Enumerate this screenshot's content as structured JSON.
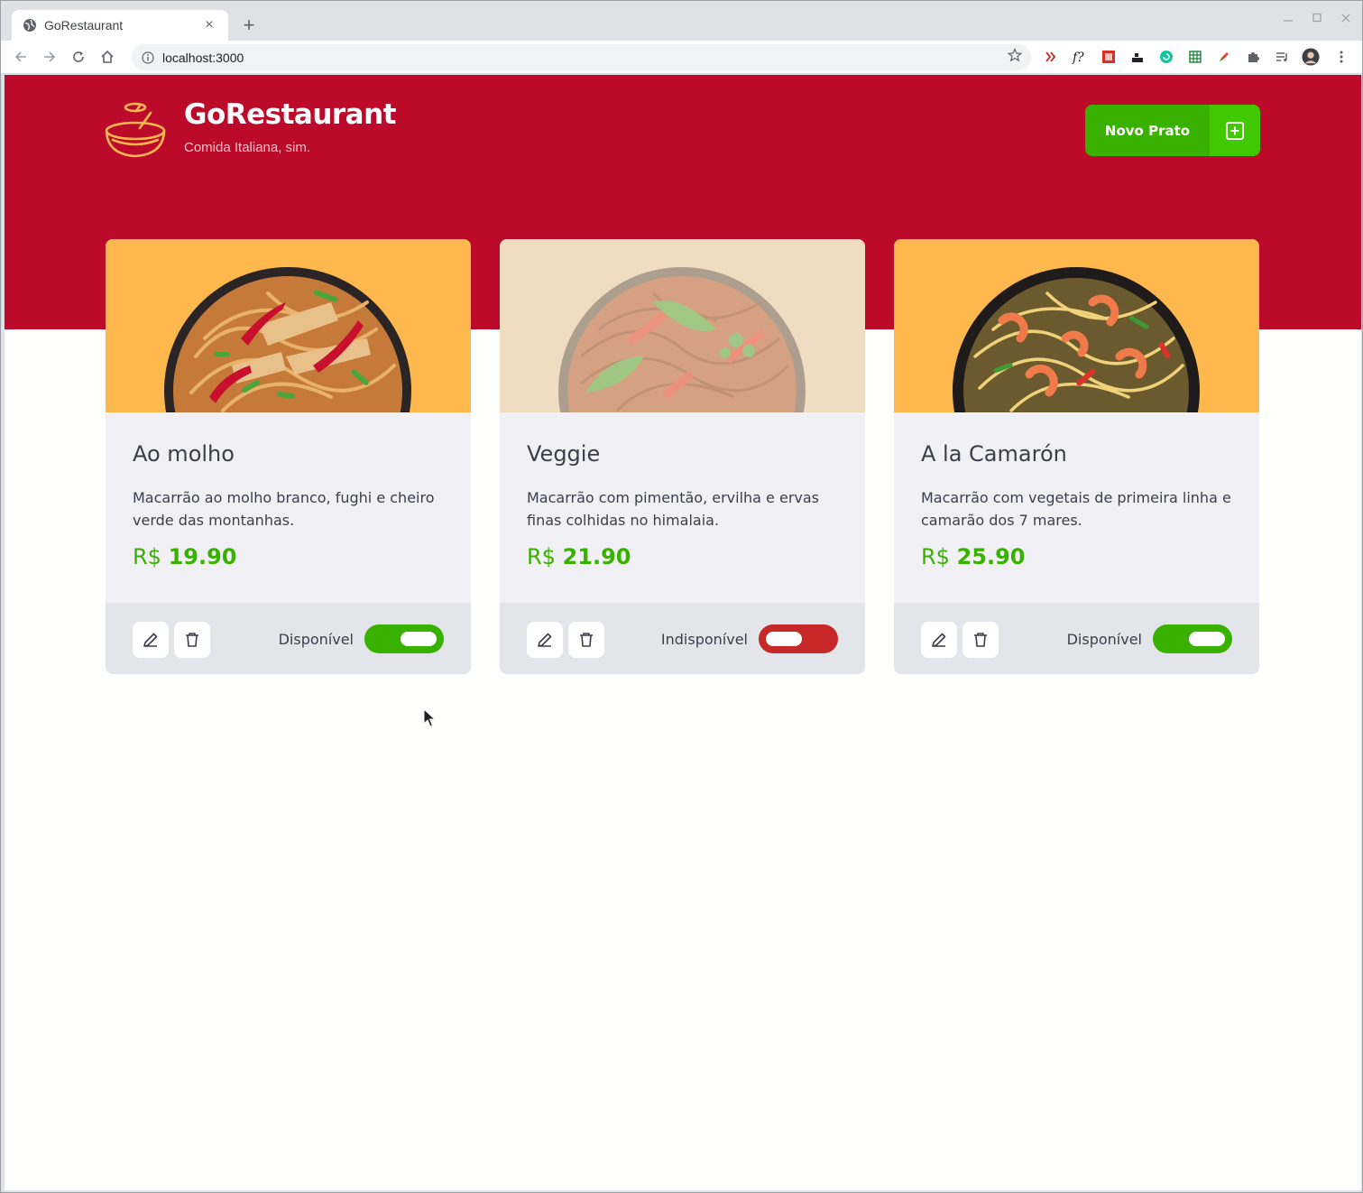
{
  "browser": {
    "tab_title": "GoRestaurant",
    "tab_close": "×",
    "new_tab": "+",
    "url": "localhost:3000"
  },
  "header": {
    "brand": "GoRestaurant",
    "tagline": "Comida Italiana, sim.",
    "new_button_label": "Novo Prato"
  },
  "foods": [
    {
      "name": "Ao molho",
      "description": "Macarrão ao molho branco, fughi e cheiro verde das montanhas.",
      "currency": "R$",
      "price": "19.90",
      "status_label": "Disponível",
      "available": true
    },
    {
      "name": "Veggie",
      "description": "Macarrão com pimentão, ervilha e ervas finas colhidas no himalaia.",
      "currency": "R$",
      "price": "21.90",
      "status_label": "Indisponível",
      "available": false
    },
    {
      "name": "A la Camarón",
      "description": "Macarrão com vegetais de primeira linha e camarão dos 7 mares.",
      "currency": "R$",
      "price": "25.90",
      "status_label": "Disponível",
      "available": true
    }
  ],
  "colors": {
    "primary_red": "#bc0a2a",
    "green": "#39b100",
    "card_bg": "#f0f0f5",
    "card_image_bg": "#ffb84d"
  }
}
